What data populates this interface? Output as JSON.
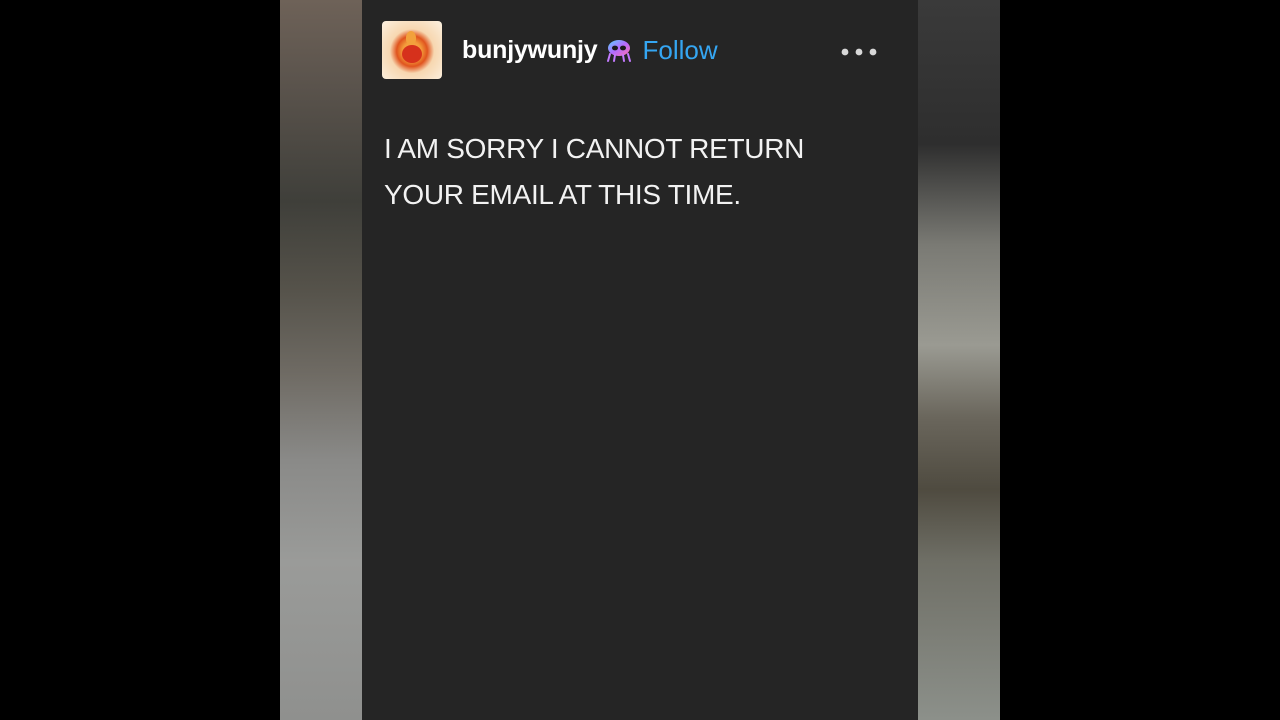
{
  "post": {
    "username": "bunjywunjy",
    "follow_label": "Follow",
    "text": "I AM SORRY I CANNOT RETURN\nYOUR EMAIL AT THIS TIME."
  },
  "icons": {
    "avatar": "goldfish-avatar",
    "badge": "alien-badge-icon",
    "more": "more-options-icon"
  },
  "colors": {
    "post_background": "#252525",
    "follow": "#35a6f2",
    "text": "#f2f2f2"
  }
}
